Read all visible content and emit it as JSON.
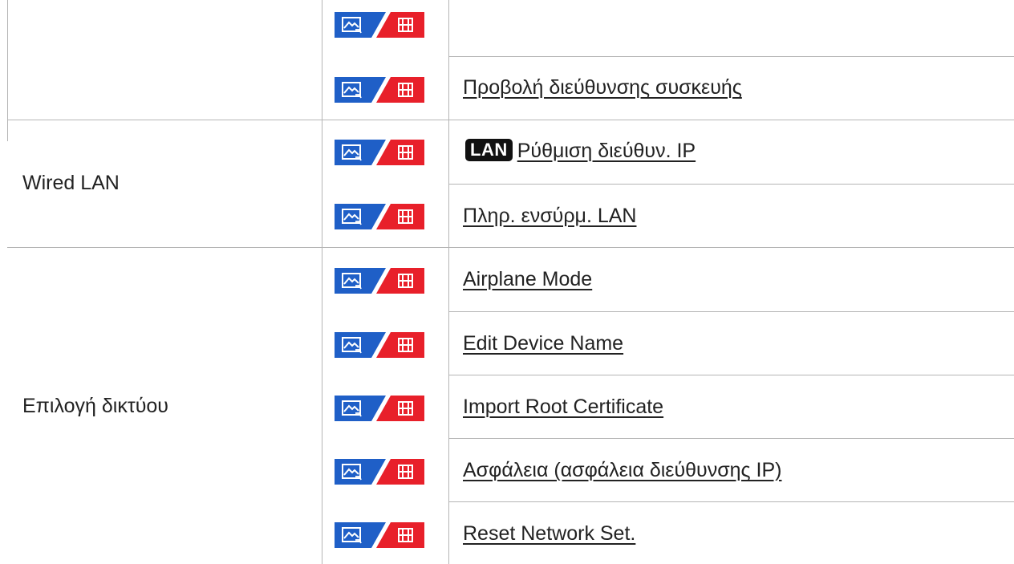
{
  "sections": [
    {
      "label": ""
    },
    {
      "label": "Wired LAN"
    },
    {
      "label": "Επιλογή δικτύου"
    }
  ],
  "rows": [
    {
      "label": ""
    },
    {
      "label": "Προβολή διεύθυνσης συσκευής"
    },
    {
      "badge": "LAN",
      "label": "Ρύθμιση διεύθυν. IP"
    },
    {
      "label": "Πληρ. ενσύρμ. LAN"
    },
    {
      "label": "Airplane Mode"
    },
    {
      "label": "Edit Device Name"
    },
    {
      "label": "Import Root Certificate"
    },
    {
      "label": "Ασφάλεια (ασφάλεια διεύθυνσης IP)"
    },
    {
      "label": "Reset Network Set."
    }
  ],
  "icons": {
    "photo_mode": "still-photo-icon",
    "movie_mode": "movie-icon",
    "photo_color": "#1f5fc7",
    "movie_color": "#e8202a"
  }
}
